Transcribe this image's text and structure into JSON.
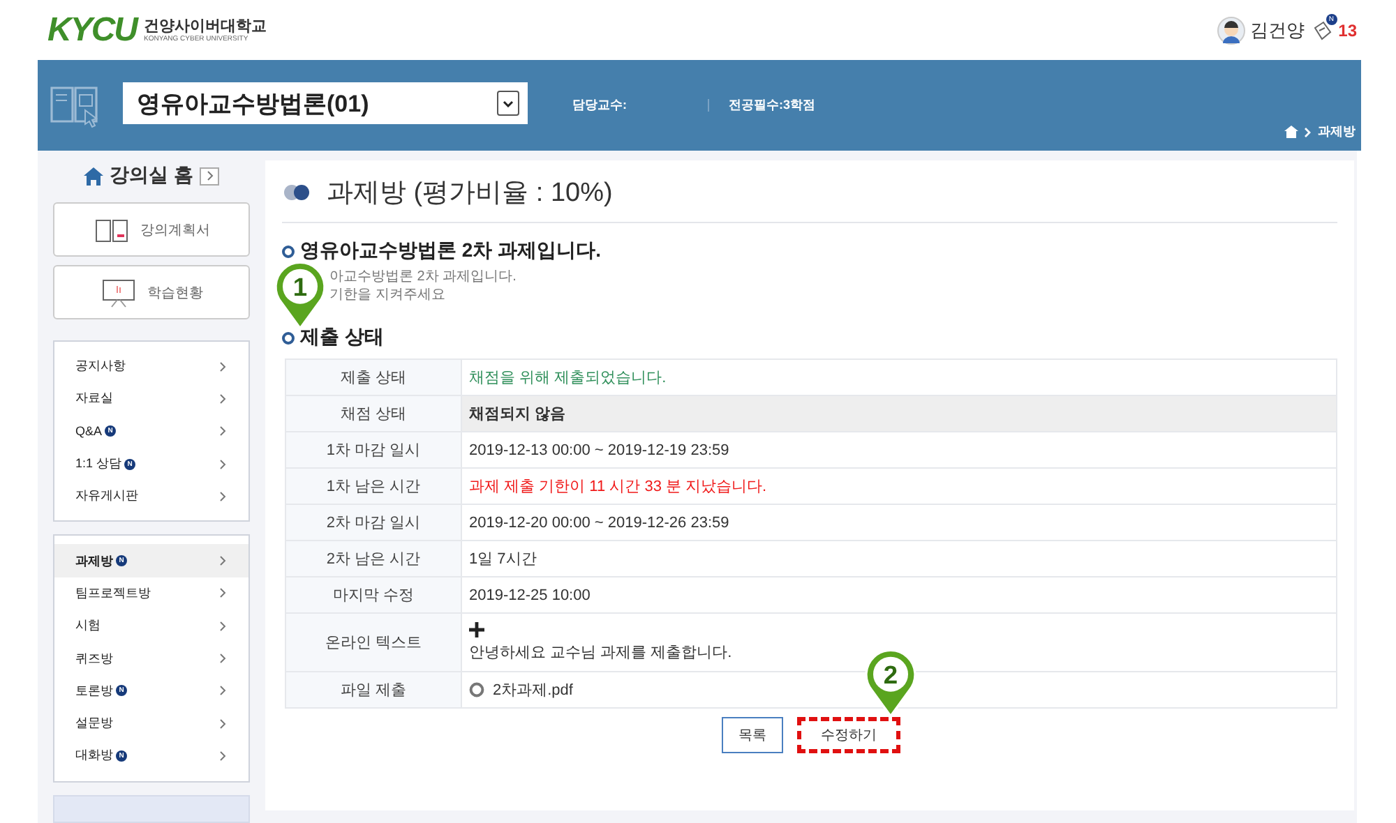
{
  "header": {
    "logo": "KYCU",
    "school_name": "건양사이버대학교",
    "school_name_en": "KONYANG CYBER UNIVERSITY",
    "user_name": "김건양",
    "notification_new": "N",
    "notification_count": "13"
  },
  "course_bar": {
    "course": "영유아교수방법론(01)",
    "professor_label": "담당교수:",
    "credit": "전공필수:3학점",
    "breadcrumb": "과제방"
  },
  "sidebar": {
    "home": "강의실 홈",
    "buttons": [
      {
        "kind": "book",
        "label": "강의계획서"
      },
      {
        "kind": "board",
        "label": "학습현황"
      }
    ],
    "groups": [
      [
        {
          "label": "공지사항",
          "selected": false
        },
        {
          "label": "자료실",
          "selected": false
        },
        {
          "label": "Q&A",
          "badge": "N",
          "selected": false
        },
        {
          "label": "1:1 상담",
          "badge": "N",
          "selected": false
        },
        {
          "label": "자유게시판",
          "selected": false
        }
      ],
      [
        {
          "label": "과제방",
          "badge": "N",
          "selected": true
        },
        {
          "label": "팀프로젝트방",
          "selected": false
        },
        {
          "label": "시험",
          "selected": false
        },
        {
          "label": "퀴즈방",
          "selected": false
        },
        {
          "label": "토론방",
          "badge": "N",
          "selected": false
        },
        {
          "label": "설문방",
          "selected": false
        },
        {
          "label": "대화방",
          "badge": "N",
          "selected": false
        }
      ]
    ]
  },
  "main": {
    "title": "과제방 (평가비율 : 10%)",
    "assignment_title": "영유아교수방법론 2차 과제입니다.",
    "description": [
      "아교수방법론 2차 과제입니다.",
      "기한을 지켜주세요"
    ],
    "section_title": "제출 상태",
    "rows": [
      {
        "label": "제출 상태",
        "kind": "success",
        "value": "채점을 위해 제출되었습니다."
      },
      {
        "label": "채점 상태",
        "kind": "bold",
        "value": "채점되지 않음"
      },
      {
        "label": "1차 마감 일시",
        "kind": "text",
        "value": "2019-12-13 00:00 ~ 2019-12-19 23:59"
      },
      {
        "label": "1차 남은 시간",
        "kind": "alert",
        "value": "과제 제출 기한이 11 시간 33 분 지났습니다."
      },
      {
        "label": "2차 마감 일시",
        "kind": "text",
        "value": "2019-12-20 00:00 ~ 2019-12-26 23:59"
      },
      {
        "label": "2차 남은 시간",
        "kind": "text",
        "value": "1일 7시간"
      },
      {
        "label": "마지막 수정",
        "kind": "text",
        "value": "2019-12-25 10:00"
      },
      {
        "label": "온라인 텍스트",
        "kind": "online",
        "value": "안녕하세요 교수님 과제를 제출합니다."
      },
      {
        "label": "파일 제출",
        "kind": "file",
        "value": "2차과제.pdf"
      }
    ],
    "buttons": [
      {
        "label": "목록",
        "highlighted": false
      },
      {
        "label": "수정하기",
        "highlighted": true
      }
    ]
  },
  "markers": [
    {
      "label": "1"
    },
    {
      "label": "2"
    }
  ]
}
